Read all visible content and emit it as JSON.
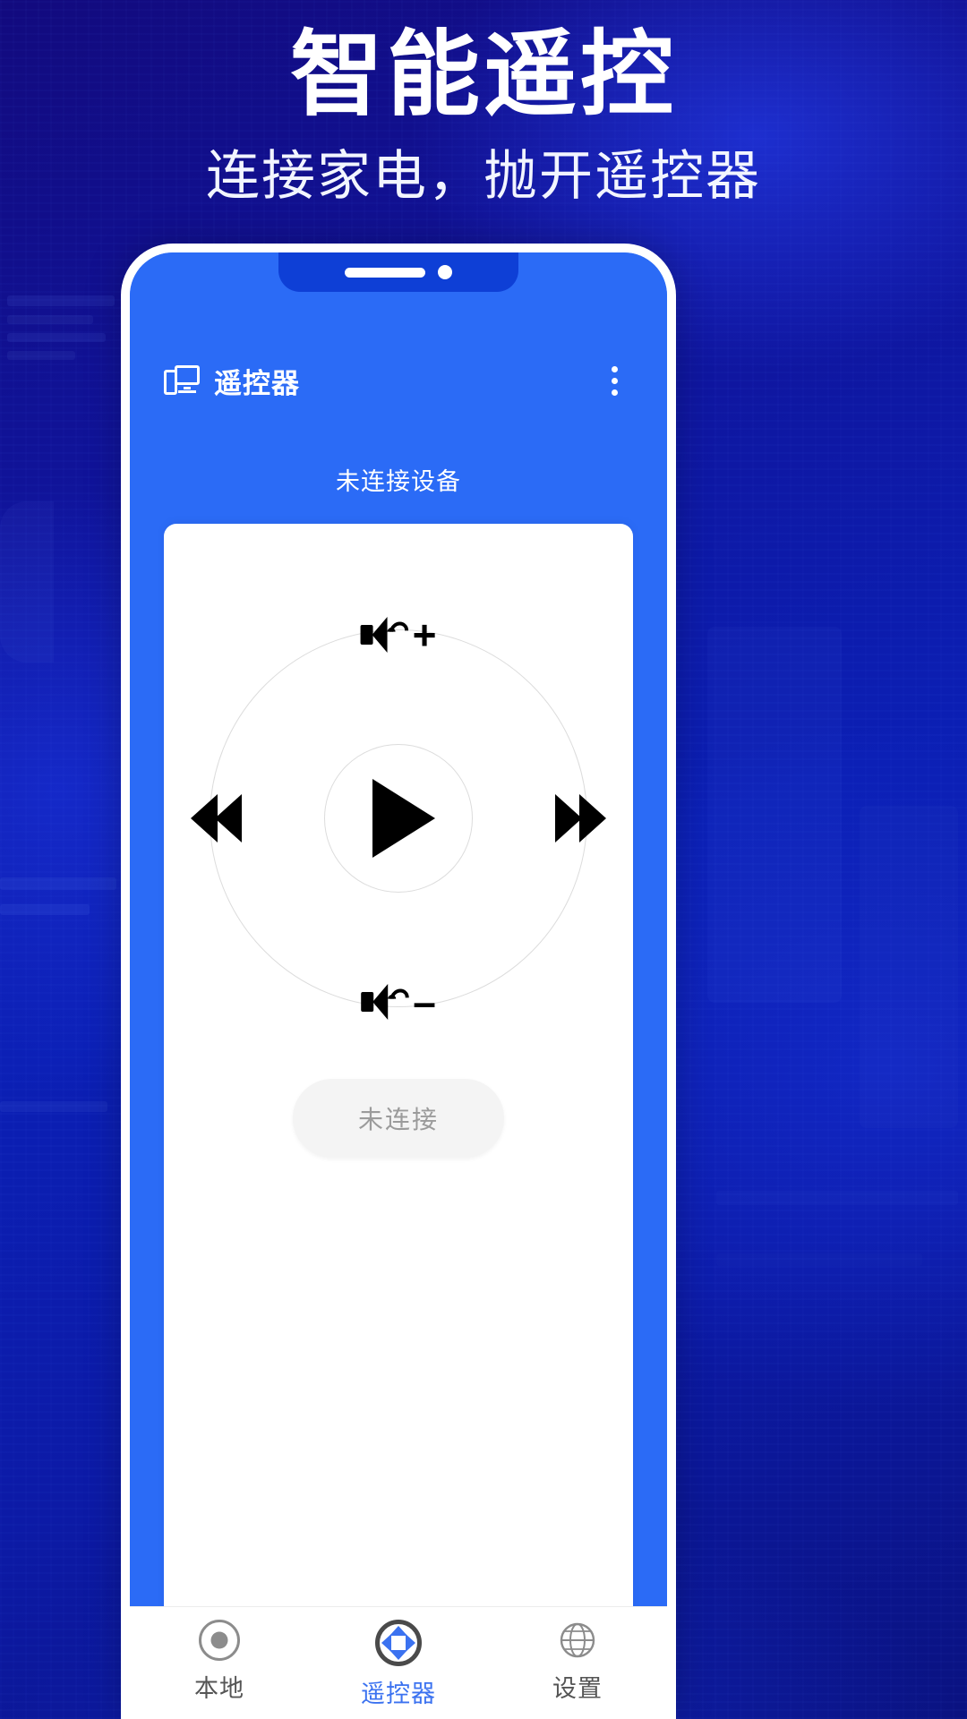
{
  "promo": {
    "title": "智能遥控",
    "subtitle": "连接家电，抛开遥控器"
  },
  "colors": {
    "background_dark": "#0a1280",
    "brand_blue": "#2b6bf6",
    "accent_blue": "#3b72f0",
    "notch": "#0e3fd6",
    "card_white": "#ffffff",
    "pill_bg": "#f4f4f4",
    "pill_text": "#9b9b9b",
    "nav_inactive": "#555555"
  },
  "phone": {
    "notch": {
      "speaker_icon": "speaker-bar",
      "camera_icon": "camera-dot"
    },
    "appbar": {
      "icon": "devices-icon",
      "title": "遥控器",
      "overflow_icon": "overflow-menu-icon"
    },
    "status_text": "未连接设备",
    "remote": {
      "volume_up": {
        "icon": "volume-up-icon",
        "sign": "+"
      },
      "volume_down": {
        "icon": "volume-down-icon",
        "sign": "–"
      },
      "previous": {
        "icon": "rewind-icon"
      },
      "next": {
        "icon": "fast-forward-icon"
      },
      "play": {
        "icon": "play-icon"
      }
    },
    "connect_button": {
      "label": "未连接"
    },
    "bottom_nav": [
      {
        "label": "本地",
        "icon": "local-icon",
        "active": false
      },
      {
        "label": "遥控器",
        "icon": "dpad-icon",
        "active": true
      },
      {
        "label": "设置",
        "icon": "settings-globe-icon",
        "active": false
      }
    ]
  }
}
